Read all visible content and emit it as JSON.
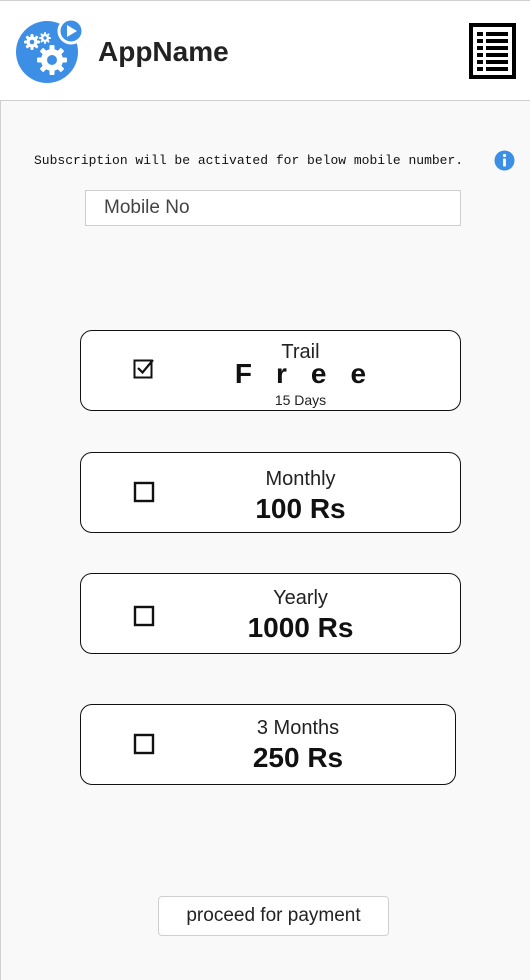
{
  "header": {
    "app_name": "AppName",
    "logo_icon": "gears-play-icon",
    "menu_icon": "list-menu-icon"
  },
  "notice": {
    "text": "Subscription will be activated for below mobile number.",
    "info_icon": "info-icon"
  },
  "mobile_input": {
    "placeholder": "Mobile No",
    "value": ""
  },
  "plans": [
    {
      "name": "Trail",
      "price": "Free",
      "sub": "15 Days",
      "checked": true
    },
    {
      "name": "Monthly",
      "price": "100 Rs",
      "checked": false
    },
    {
      "name": "Yearly",
      "price": "1000 Rs",
      "checked": false
    },
    {
      "name": "3 Months",
      "price": "250 Rs",
      "checked": false
    }
  ],
  "actions": {
    "proceed_label": "proceed for payment"
  },
  "colors": {
    "accent": "#3d8fe6",
    "border": "#111111",
    "background": "#f9f9f9"
  }
}
